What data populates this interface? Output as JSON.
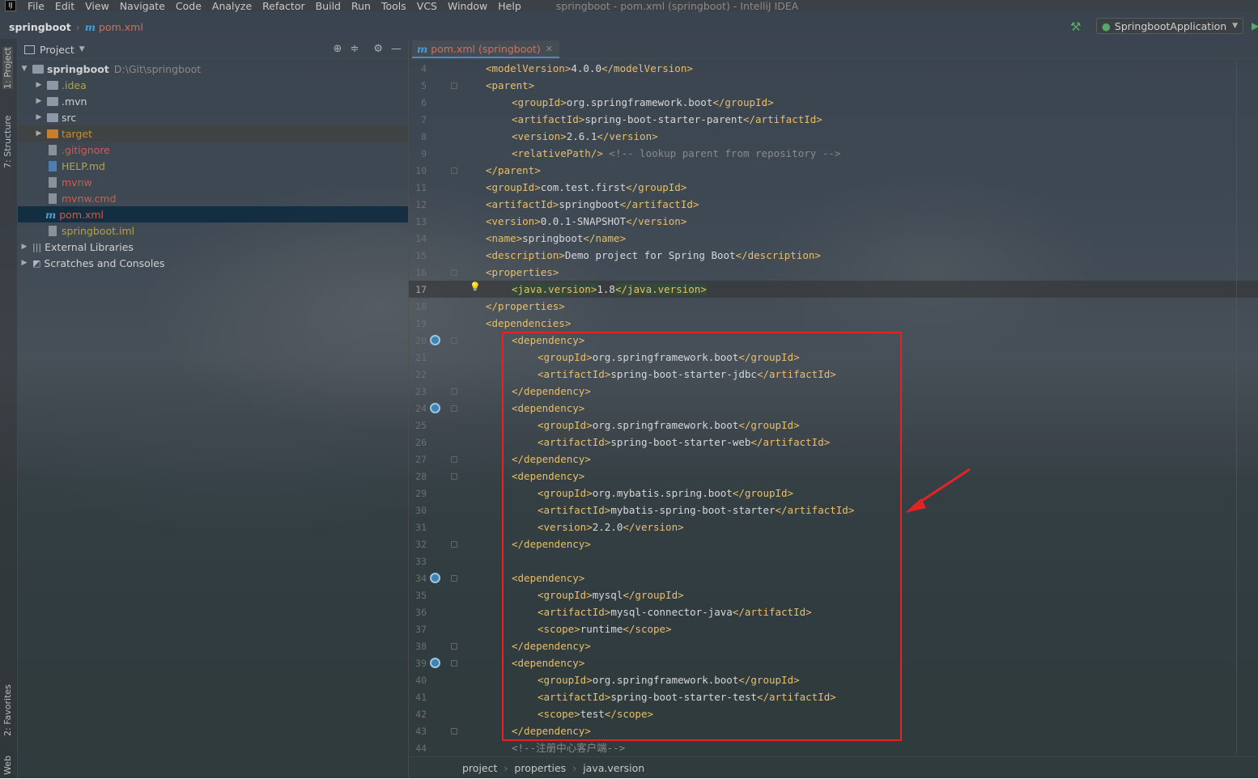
{
  "menubar": {
    "items": [
      "File",
      "Edit",
      "View",
      "Navigate",
      "Code",
      "Analyze",
      "Refactor",
      "Build",
      "Run",
      "Tools",
      "VCS",
      "Window",
      "Help"
    ],
    "window_title": "springboot - pom.xml (springboot) - IntelliJ IDEA"
  },
  "navbar": {
    "project": "springboot",
    "file": "pom.xml",
    "run_config": "SpringbootApplication"
  },
  "stripe": {
    "project": "1: Project",
    "structure": "7: Structure",
    "favorites": "2: Favorites",
    "web": "Web"
  },
  "project_panel": {
    "title": "Project",
    "root": {
      "name": "springboot",
      "path": "D:\\Git\\springboot"
    },
    "items": [
      {
        "name": ".idea",
        "kind": "folder"
      },
      {
        "name": ".mvn",
        "kind": "folder"
      },
      {
        "name": "src",
        "kind": "folder"
      },
      {
        "name": "target",
        "kind": "folder-excluded"
      },
      {
        "name": ".gitignore",
        "kind": "file"
      },
      {
        "name": "HELP.md",
        "kind": "file"
      },
      {
        "name": "mvnw",
        "kind": "file"
      },
      {
        "name": "mvnw.cmd",
        "kind": "file"
      },
      {
        "name": "pom.xml",
        "kind": "file"
      },
      {
        "name": "springboot.iml",
        "kind": "file"
      }
    ],
    "external_libraries": "External Libraries",
    "scratches": "Scratches and Consoles"
  },
  "editor": {
    "tab_label": "pom.xml (springboot)",
    "line_numbers": [
      "4",
      "5",
      "6",
      "7",
      "8",
      "9",
      "10",
      "11",
      "12",
      "13",
      "14",
      "15",
      "16",
      "17",
      "18",
      "19",
      "20",
      "21",
      "22",
      "23",
      "24",
      "25",
      "26",
      "27",
      "28",
      "29",
      "30",
      "31",
      "32",
      "33",
      "34",
      "35",
      "36",
      "37",
      "38",
      "39",
      "40",
      "41",
      "42",
      "43",
      "44"
    ],
    "current_line": "17",
    "lines": [
      {
        "indent": 1,
        "open": "modelVersion",
        "text": "4.0.0"
      },
      {
        "indent": 1,
        "raw": "<parent>"
      },
      {
        "indent": 2,
        "open": "groupId",
        "text": "org.springframework.boot"
      },
      {
        "indent": 2,
        "open": "artifactId",
        "text": "spring-boot-starter-parent"
      },
      {
        "indent": 2,
        "open": "version",
        "text": "2.6.1"
      },
      {
        "indent": 2,
        "raw": "<relativePath/>",
        "comment": " <!-- lookup parent from repository -->"
      },
      {
        "indent": 1,
        "raw": "</parent>"
      },
      {
        "indent": 1,
        "open": "groupId",
        "text": "com.test.first"
      },
      {
        "indent": 1,
        "open": "artifactId",
        "text": "springboot"
      },
      {
        "indent": 1,
        "open": "version",
        "text": "0.0.1-SNAPSHOT"
      },
      {
        "indent": 1,
        "open": "name",
        "text": "springboot"
      },
      {
        "indent": 1,
        "open": "description",
        "text": "Demo project for Spring Boot"
      },
      {
        "indent": 1,
        "raw": "<properties>"
      },
      {
        "indent": 2,
        "open": "java.version",
        "text": "1.8",
        "highlight": true
      },
      {
        "indent": 1,
        "raw": "</properties>"
      },
      {
        "indent": 1,
        "raw": "<dependencies>"
      },
      {
        "indent": 2,
        "raw": "<dependency>"
      },
      {
        "indent": 3,
        "open": "groupId",
        "text": "org.springframework.boot"
      },
      {
        "indent": 3,
        "open": "artifactId",
        "text": "spring-boot-starter-jdbc"
      },
      {
        "indent": 2,
        "raw": "</dependency>"
      },
      {
        "indent": 2,
        "raw": "<dependency>"
      },
      {
        "indent": 3,
        "open": "groupId",
        "text": "org.springframework.boot"
      },
      {
        "indent": 3,
        "open": "artifactId",
        "text": "spring-boot-starter-web"
      },
      {
        "indent": 2,
        "raw": "</dependency>"
      },
      {
        "indent": 2,
        "raw": "<dependency>"
      },
      {
        "indent": 3,
        "open": "groupId",
        "text": "org.mybatis.spring.boot"
      },
      {
        "indent": 3,
        "open": "artifactId",
        "text": "mybatis-spring-boot-starter"
      },
      {
        "indent": 3,
        "open": "version",
        "text": "2.2.0"
      },
      {
        "indent": 2,
        "raw": "</dependency>"
      },
      {
        "indent": 0,
        "raw": ""
      },
      {
        "indent": 2,
        "raw": "<dependency>"
      },
      {
        "indent": 3,
        "open": "groupId",
        "text": "mysql"
      },
      {
        "indent": 3,
        "open": "artifactId",
        "text": "mysql-connector-java"
      },
      {
        "indent": 3,
        "open": "scope",
        "text": "runtime"
      },
      {
        "indent": 2,
        "raw": "</dependency>"
      },
      {
        "indent": 2,
        "raw": "<dependency>"
      },
      {
        "indent": 3,
        "open": "groupId",
        "text": "org.springframework.boot"
      },
      {
        "indent": 3,
        "open": "artifactId",
        "text": "spring-boot-starter-test"
      },
      {
        "indent": 3,
        "open": "scope",
        "text": "test"
      },
      {
        "indent": 2,
        "raw": "</dependency>"
      },
      {
        "indent": 2,
        "comment_only": "<!--注册中心客户端-->"
      }
    ]
  },
  "statusbar": {
    "crumbs": [
      "project",
      "properties",
      "java.version"
    ]
  },
  "colors": {
    "tag": "#e8bf6a",
    "text": "#d7d7d7",
    "comment": "#8a8a8a",
    "annotation_box": "#e42424",
    "selection": "#0d293e"
  }
}
